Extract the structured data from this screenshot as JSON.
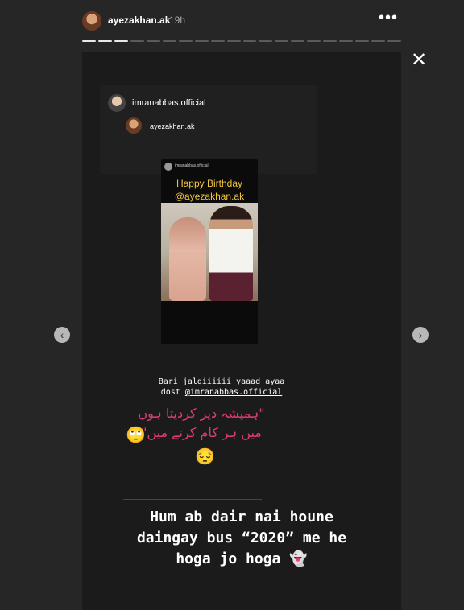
{
  "header": {
    "username": "ayezakhan.ak",
    "time": "19h",
    "more_icon": "•••",
    "progress": {
      "total": 20,
      "completed": 3
    }
  },
  "controls": {
    "close_icon": "✕",
    "prev_icon": "‹",
    "next_icon": "›"
  },
  "repost": {
    "author": "imranabbas.official",
    "mention": "ayezakhan.ak"
  },
  "post": {
    "account": "imranabbas.official",
    "line1": "Happy Birthday",
    "line2": "@ayezakhan.ak"
  },
  "caption": {
    "line1": "Bari jaldiiiiii yaaad ayaa",
    "line2_prefix": "dost ",
    "mention": "@imranabbas.official"
  },
  "urdu": {
    "line1": "\"ہمیشہ دیر کردیتا ہوں",
    "line2": "میں ہر کام کرنے میں\""
  },
  "emojis": {
    "eyes": "🙄",
    "pensive": "😔"
  },
  "big_text": {
    "line1": "Hum ab dair nai houne",
    "line2": "daingay bus “2020” me he",
    "line3": "hoga jo hoga 👻"
  },
  "colors": {
    "accent_pink": "#e03a7a",
    "title_yellow": "#f1c63c"
  }
}
